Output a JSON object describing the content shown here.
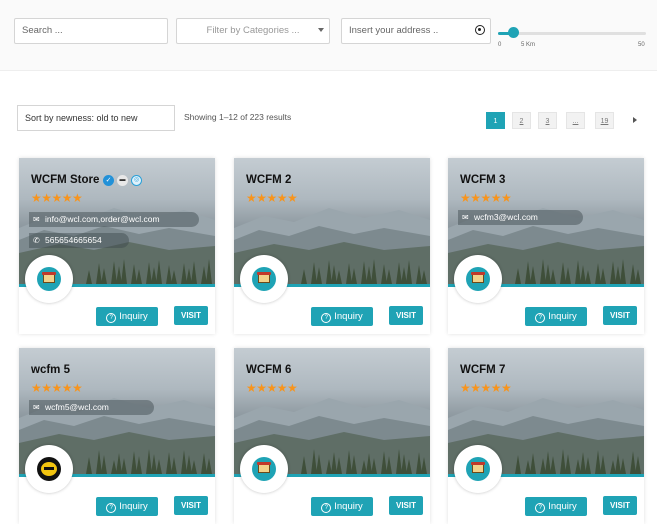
{
  "filters": {
    "search_placeholder": "Search ...",
    "category_placeholder": "Filter by Categories ...",
    "address_placeholder": "Insert your address ..",
    "slider": {
      "min_label": "0",
      "value_label": "5 Km",
      "max_label": "50",
      "value_fraction": 0.1
    }
  },
  "listing": {
    "sort_value": "Sort by newness: old to new",
    "result_count": "Showing 1–12 of 223 results",
    "pagination": [
      "1",
      "2",
      "3",
      "...",
      "19"
    ]
  },
  "buttons": {
    "inquiry_label": "Inquiry",
    "visit_label": "VISIT"
  },
  "colors": {
    "accent": "#1fa3b5",
    "star": "#f7941d"
  },
  "stores": [
    {
      "name": "WCFM Store",
      "stars": "★★★★★",
      "email": "info@wcl.com,order@wcl.com",
      "phone": "565654665654",
      "badges": true,
      "logo": "store-logo-icon"
    },
    {
      "name": "WCFM 2",
      "stars": "★★★★★",
      "logo": "store-logo-icon"
    },
    {
      "name": "WCFM 3",
      "stars": "★★★★★",
      "email": "wcfm3@wcl.com",
      "logo": "store-logo-icon"
    },
    {
      "name": "wcfm 5",
      "stars": "★★★★★",
      "email": "wcfm5@wcl.com",
      "logo": "bfm-logo-icon"
    },
    {
      "name": "WCFM 6",
      "stars": "★★★★★",
      "logo": "store-logo-icon"
    },
    {
      "name": "WCFM 7",
      "stars": "★★★★★",
      "logo": "store-logo-icon"
    }
  ]
}
